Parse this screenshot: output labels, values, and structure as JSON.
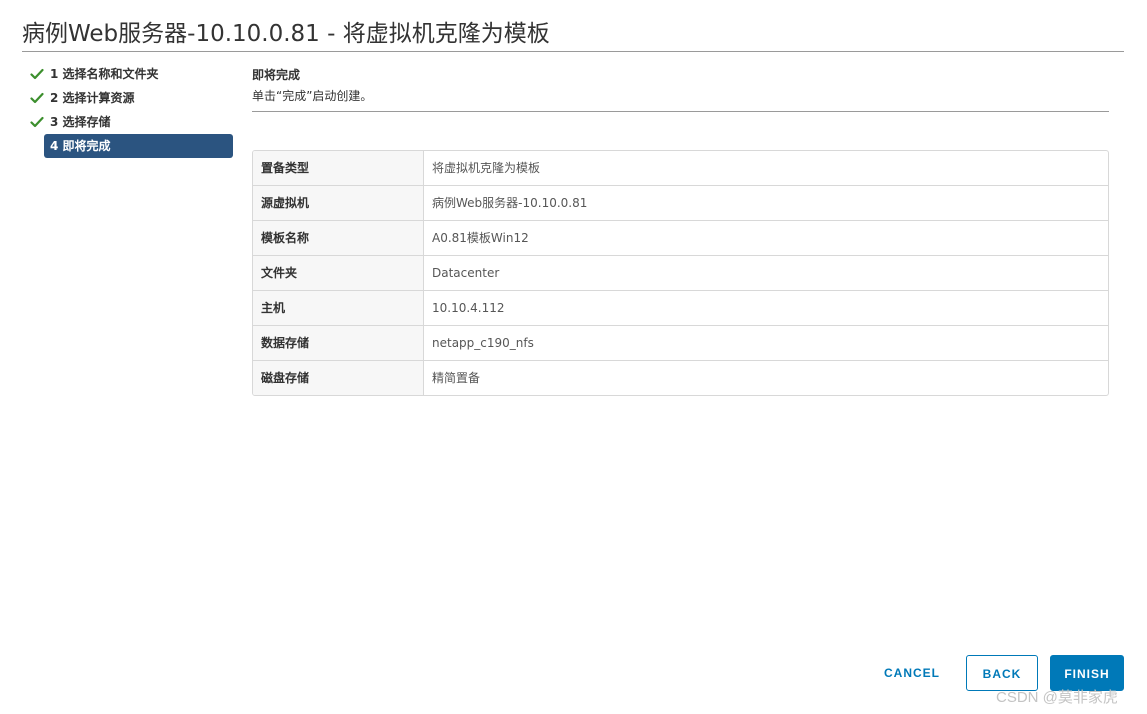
{
  "window": {
    "title": "病例Web服务器-10.10.0.81 - 将虚拟机克隆为模板"
  },
  "steps": [
    {
      "label": "1 选择名称和文件夹",
      "completed": true,
      "active": false
    },
    {
      "label": "2 选择计算资源",
      "completed": true,
      "active": false
    },
    {
      "label": "3 选择存储",
      "completed": true,
      "active": false
    },
    {
      "label": "4 即将完成",
      "completed": false,
      "active": true
    }
  ],
  "main": {
    "heading": "即将完成",
    "subheading": "单击“完成”启动创建。",
    "summary": [
      {
        "label": "置备类型",
        "value": "将虚拟机克隆为模板"
      },
      {
        "label": "源虚拟机",
        "value": "病例Web服务器-10.10.0.81"
      },
      {
        "label": "模板名称",
        "value": "A0.81模板Win12"
      },
      {
        "label": "文件夹",
        "value": "Datacenter"
      },
      {
        "label": "主机",
        "value": "10.10.4.112"
      },
      {
        "label": "数据存储",
        "value": "netapp_c190_nfs"
      },
      {
        "label": "磁盘存储",
        "value": "精简置备"
      }
    ]
  },
  "footer": {
    "cancel_label": "CANCEL",
    "back_label": "BACK",
    "finish_label": "FINISH"
  },
  "watermark": "CSDN @莫非家虎",
  "colors": {
    "accent": "#0079b8",
    "active_step_bg": "#2b5480",
    "check": "#3c8f2d"
  }
}
